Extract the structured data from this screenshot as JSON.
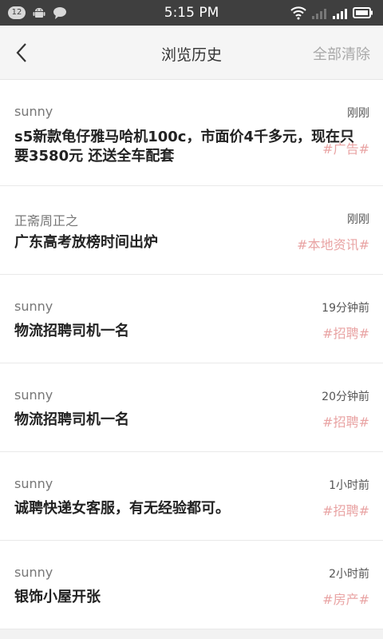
{
  "status_bar": {
    "notification_count": "12",
    "time": "5:15 PM",
    "icons": [
      "android-icon",
      "chat-bubble-icon",
      "wifi-icon",
      "signal-weak-icon",
      "signal-icon",
      "battery-icon"
    ]
  },
  "header": {
    "title": "浏览历史",
    "clear_all": "全部清除",
    "back_icon": "chevron-left-icon"
  },
  "colors": {
    "status_bar": "#3f3f3f",
    "tag": "#e9a4a4",
    "clear_all": "#a8a8a8"
  },
  "items": [
    {
      "author": "sunny",
      "time": "刚刚",
      "title_line1": "s5新款龟仔雅马哈机100c，市面价4千多元，现在只",
      "title_line2": "要3580元 还送全车配套",
      "tag": "#广告#"
    },
    {
      "author": "正斋周正之",
      "time": "刚刚",
      "title_line1": "广东高考放榜时间出炉",
      "title_line2": "",
      "tag": "#本地资讯#"
    },
    {
      "author": "sunny",
      "time": "19分钟前",
      "title_line1": "物流招聘司机一名",
      "title_line2": "",
      "tag": "#招聘#"
    },
    {
      "author": "sunny",
      "time": "20分钟前",
      "title_line1": "物流招聘司机一名",
      "title_line2": "",
      "tag": "#招聘#"
    },
    {
      "author": "sunny",
      "time": "1小时前",
      "title_line1": "诚聘快递女客服，有无经验都可。",
      "title_line2": "",
      "tag": "#招聘#"
    },
    {
      "author": "sunny",
      "time": "2小时前",
      "title_line1": "银饰小屋开张",
      "title_line2": "",
      "tag": "#房产#"
    }
  ]
}
